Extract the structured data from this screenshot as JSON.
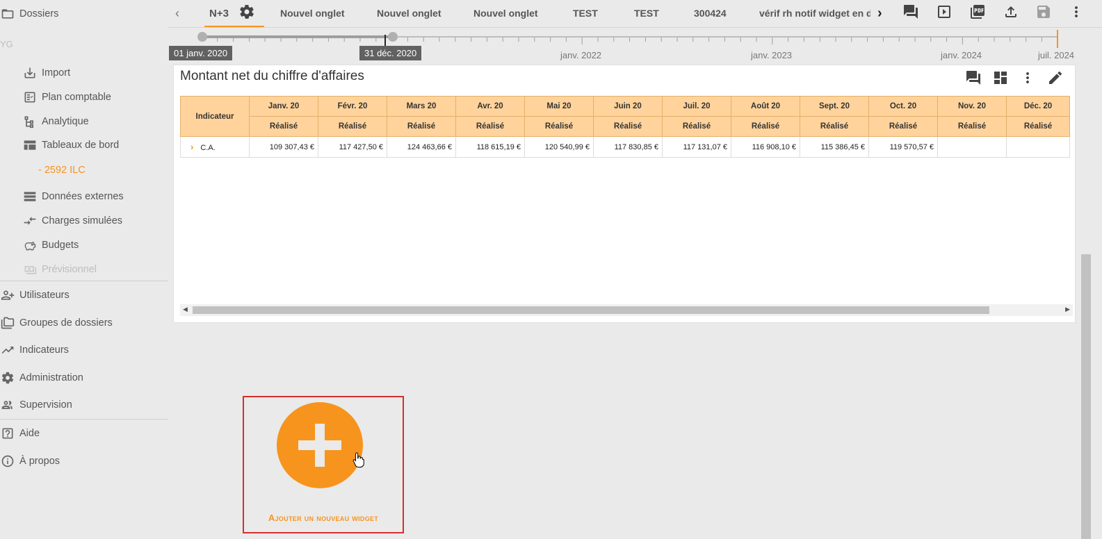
{
  "sidebar": {
    "dossiers": "Dossiers",
    "yg": "YG",
    "items": [
      {
        "label": "Import",
        "icon": "download-icon"
      },
      {
        "label": "Plan comptable",
        "icon": "checklist-icon"
      },
      {
        "label": "Analytique",
        "icon": "hierarchy-icon"
      },
      {
        "label": "Tableaux de bord",
        "icon": "dashboard-icon"
      },
      {
        "label": "- 2592 ILC"
      },
      {
        "label": "Données externes",
        "icon": "list-icon"
      },
      {
        "label": "Charges simulées",
        "icon": "compare-arrows-icon"
      },
      {
        "label": "Budgets",
        "icon": "piggy-bank-icon"
      },
      {
        "label": "Prévisionnel",
        "icon": "money-icon"
      }
    ],
    "admin": [
      {
        "label": "Utilisateurs",
        "icon": "user-add-icon"
      },
      {
        "label": "Groupes de dossiers",
        "icon": "folders-icon"
      },
      {
        "label": "Indicateurs",
        "icon": "trend-icon"
      },
      {
        "label": "Administration",
        "icon": "gear-icon"
      },
      {
        "label": "Supervision",
        "icon": "people-icon"
      }
    ],
    "help": [
      {
        "label": "Aide",
        "icon": "help-icon"
      },
      {
        "label": "À propos",
        "icon": "info-icon"
      }
    ]
  },
  "tabs": {
    "active": "N+3",
    "items": [
      "Nouvel onglet",
      "Nouvel onglet",
      "Nouvel onglet",
      "TEST",
      "TEST",
      "300424",
      "vérif rh notif widget en d"
    ]
  },
  "timeline": {
    "start_badge": "01 janv. 2020",
    "end_badge": "31 déc. 2020",
    "labels": [
      "janv. 2022",
      "janv. 2023",
      "janv. 2024",
      "juil. 2024"
    ]
  },
  "widget": {
    "title": "Montant net du chiffre d'affaires",
    "header_indicator": "Indicateur",
    "months": [
      "Janv. 20",
      "Févr. 20",
      "Mars 20",
      "Avr. 20",
      "Mai 20",
      "Juin 20",
      "Juil. 20",
      "Août 20",
      "Sept. 20",
      "Oct. 20",
      "Nov. 20",
      "Déc. 20"
    ],
    "sub_header": "Réalisé",
    "row": {
      "label": "C.A.",
      "values": [
        "109 307,43 €",
        "117 427,50 €",
        "124 463,66 €",
        "118 615,19 €",
        "120 540,99 €",
        "117 830,85 €",
        "117 131,07 €",
        "116 908,10 €",
        "115 386,45 €",
        "119 570,57 €",
        "",
        ""
      ]
    }
  },
  "add_widget": {
    "label": "Ajouter un nouveau widget"
  },
  "colors": {
    "accent": "#f7941d",
    "header_bg": "#ffd39b",
    "highlight_border": "#d32f2f"
  }
}
